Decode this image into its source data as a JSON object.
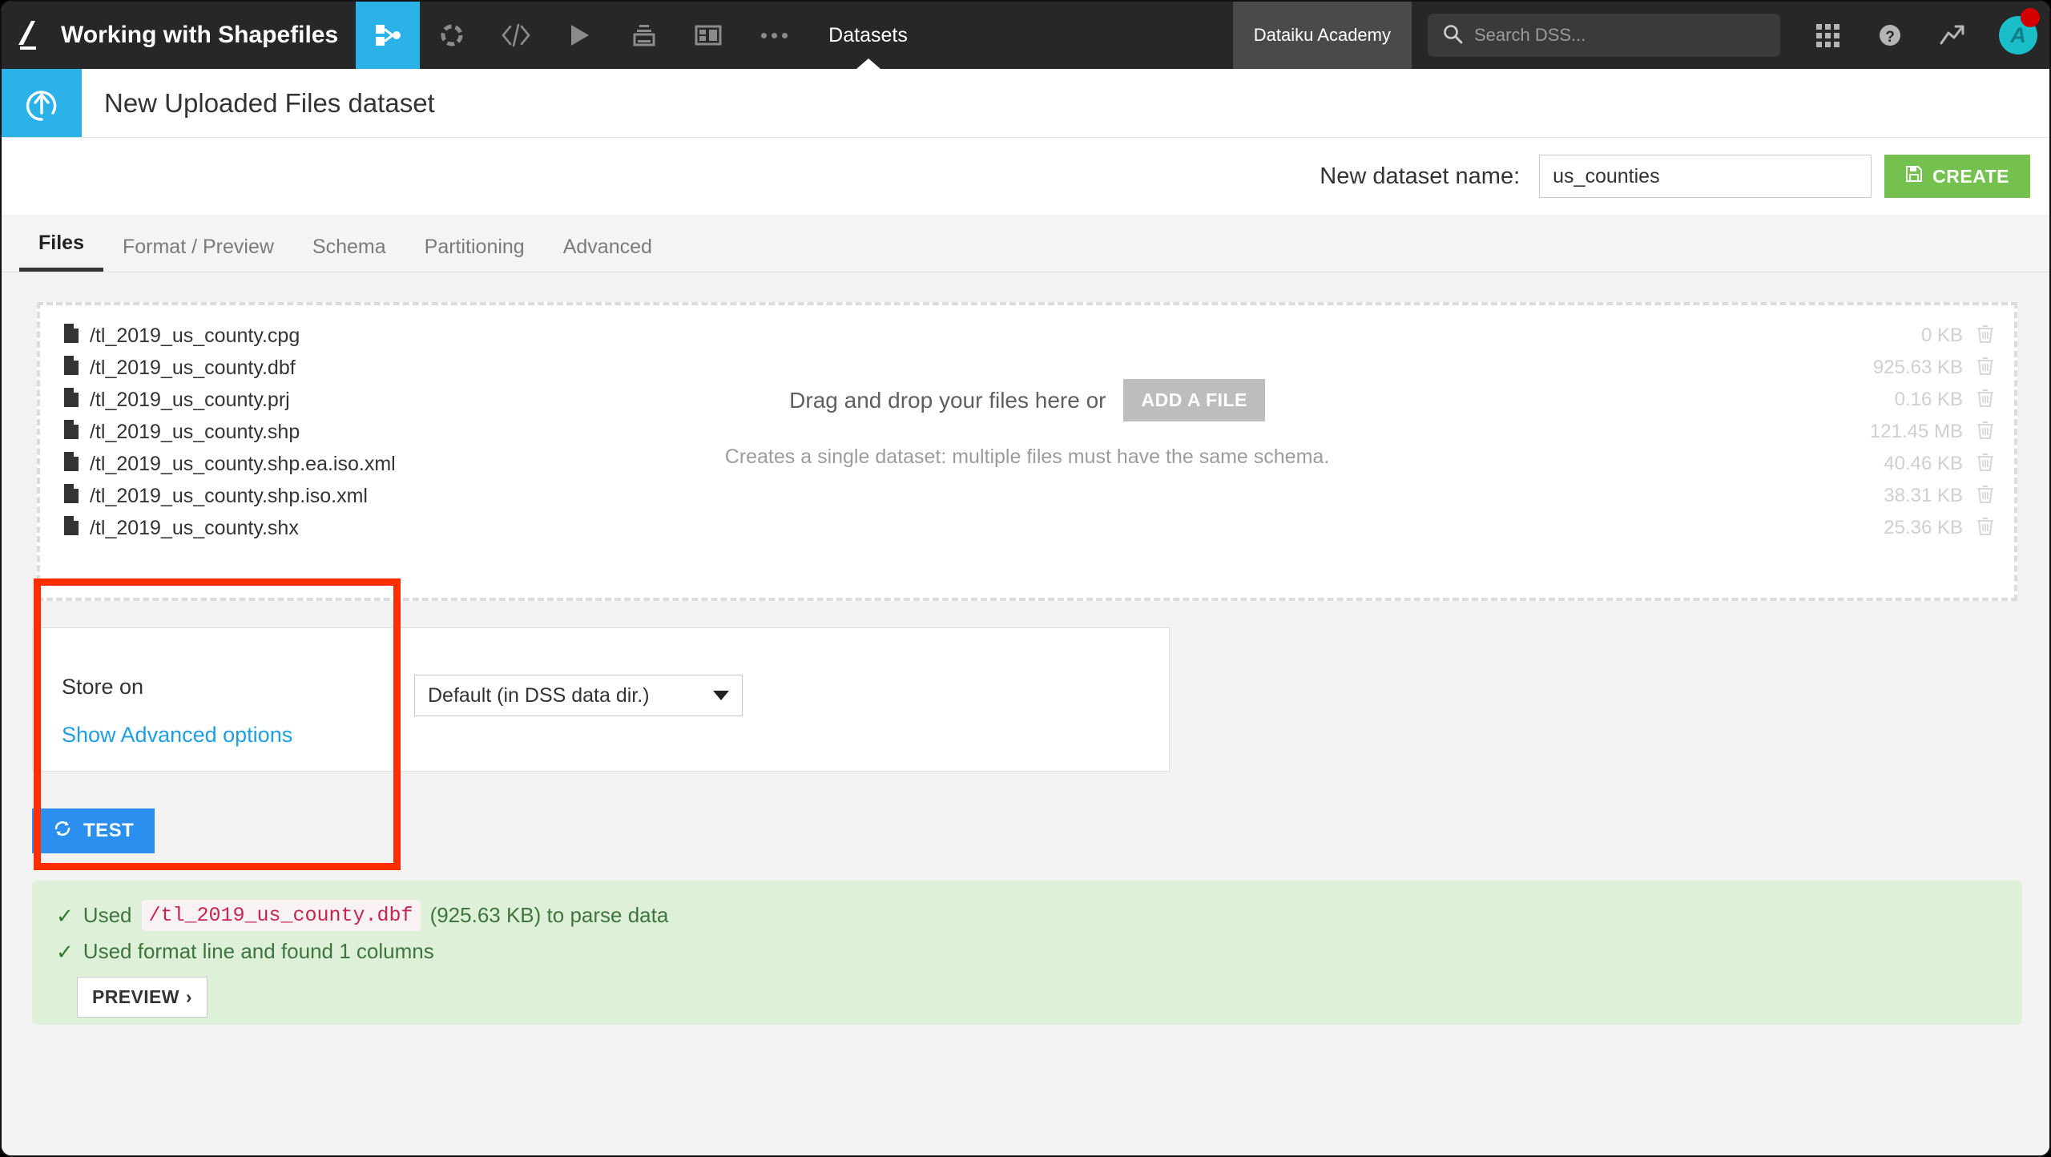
{
  "topnav": {
    "logo_icon": "dataiku-logo-icon",
    "project_name": "Working with Shapefiles",
    "icons": [
      {
        "name": "flow-icon",
        "active": true
      },
      {
        "name": "lab-icon",
        "active": false
      },
      {
        "name": "code-icon",
        "active": false
      },
      {
        "name": "scenarios-icon",
        "active": false
      },
      {
        "name": "jobs-icon",
        "active": false
      },
      {
        "name": "dashboards-icon",
        "active": false
      }
    ],
    "more_icon": "more-dots-icon",
    "section_label": "Datasets",
    "academy_label": "Dataiku Academy",
    "search": {
      "icon": "search-icon",
      "placeholder": "Search DSS...",
      "value": ""
    },
    "apps_icon": "apps-grid-icon",
    "help_icon": "help-icon",
    "activity_icon": "trend-up-icon",
    "avatar_initial": "A",
    "avatar_color": "#1abec8",
    "notification_color": "#d40000"
  },
  "header": {
    "badge_icon": "upload-arrow-icon",
    "badge_color": "#2ab1e8",
    "title": "New Uploaded Files dataset"
  },
  "name_bar": {
    "label": "New dataset name:",
    "value": "us_counties",
    "placeholder": "",
    "create_label": "CREATE",
    "create_icon": "save-disk-icon",
    "create_color": "#74c14f"
  },
  "tabs": [
    {
      "label": "Files",
      "active": true
    },
    {
      "label": "Format / Preview",
      "active": false
    },
    {
      "label": "Schema",
      "active": false
    },
    {
      "label": "Partitioning",
      "active": false
    },
    {
      "label": "Advanced",
      "active": false
    }
  ],
  "dropzone": {
    "prompt": "Drag and drop your files here or",
    "add_file_label": "ADD A FILE",
    "subtitle": "Creates a single dataset: multiple files must have the same schema.",
    "files": [
      {
        "name": "/tl_2019_us_county.cpg",
        "size": "0 KB"
      },
      {
        "name": "/tl_2019_us_county.dbf",
        "size": "925.63 KB"
      },
      {
        "name": "/tl_2019_us_county.prj",
        "size": "0.16 KB"
      },
      {
        "name": "/tl_2019_us_county.shp",
        "size": "121.45 MB"
      },
      {
        "name": "/tl_2019_us_county.shp.ea.iso.xml",
        "size": "40.46 KB"
      },
      {
        "name": "/tl_2019_us_county.shp.iso.xml",
        "size": "38.31 KB"
      },
      {
        "name": "/tl_2019_us_county.shx",
        "size": "25.36 KB"
      }
    ]
  },
  "store": {
    "label": "Store on",
    "selected": "Default (in DSS data dir.)",
    "advanced_link": "Show Advanced options"
  },
  "test": {
    "label": "TEST",
    "icon": "refresh-icon",
    "color": "#2b8fef"
  },
  "result": {
    "line1_prefix": "Used",
    "line1_code": "/tl_2019_us_county.dbf",
    "line1_suffix": "(925.63 KB) to parse data",
    "line2": "Used format line and found 1 columns",
    "preview_label": "PREVIEW",
    "preview_chevron": "›",
    "background": "#dff0d8",
    "text_color": "#3c763d"
  },
  "annotation": {
    "type": "red-rectangle-highlight",
    "color": "#ff2d00",
    "target": "file-list"
  }
}
